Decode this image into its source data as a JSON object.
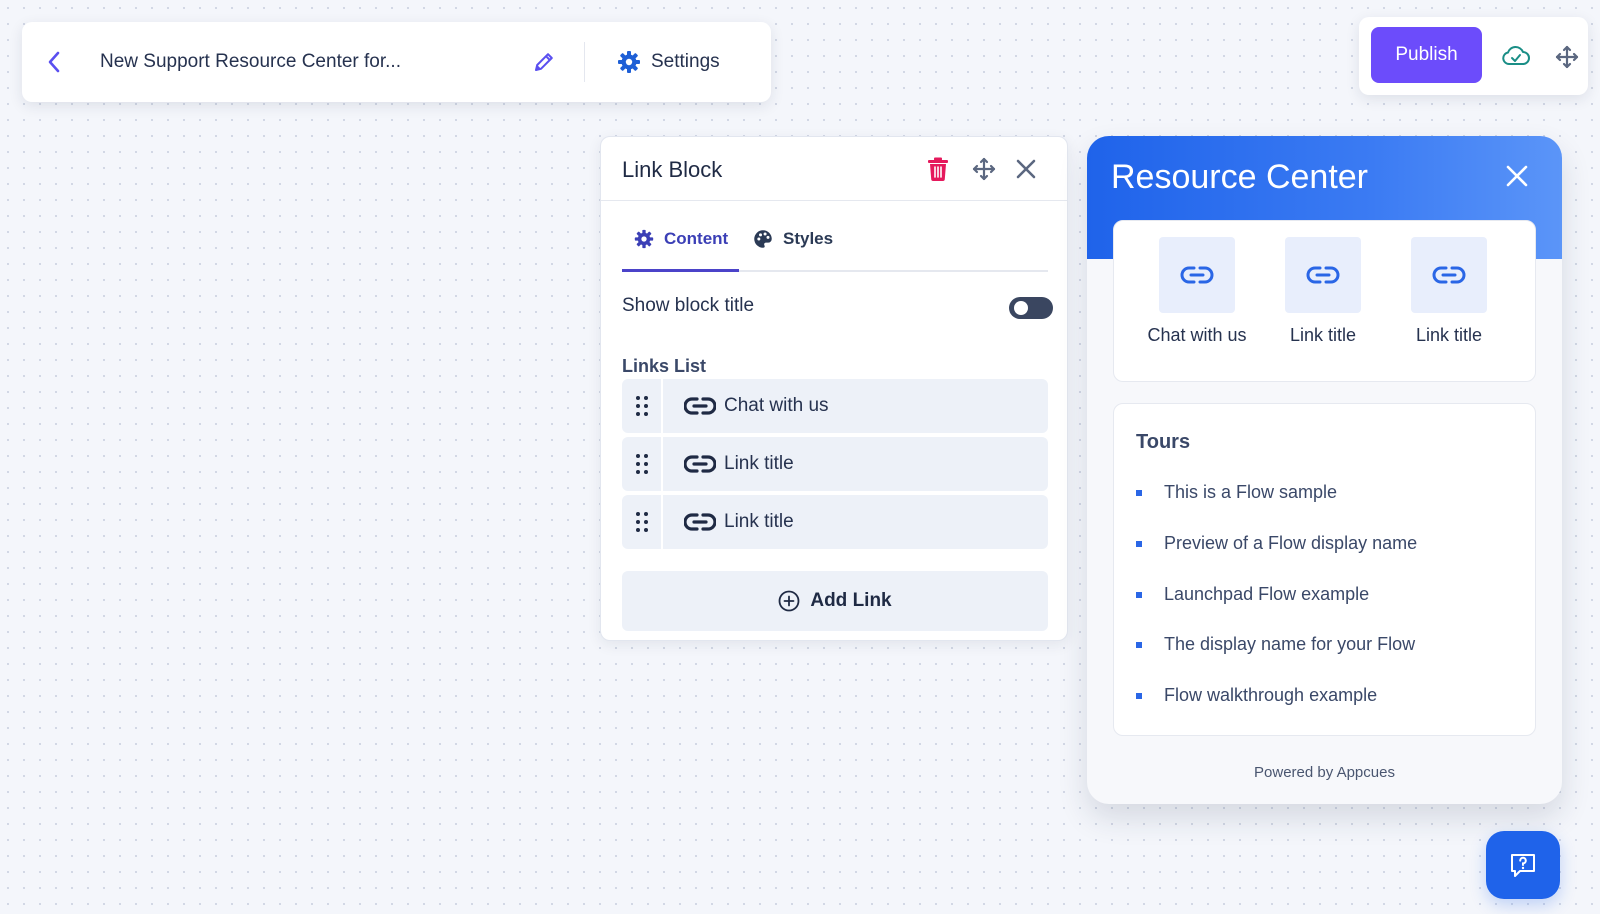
{
  "header": {
    "flow_name": "New Support Resource Center for...",
    "settings_label": "Settings"
  },
  "publish": {
    "publish_label": "Publish"
  },
  "link_block": {
    "title": "Link Block",
    "tabs": [
      {
        "label": "Content",
        "icon": "gear-icon",
        "active": true
      },
      {
        "label": "Styles",
        "icon": "palette-icon",
        "active": false
      }
    ],
    "show_block_title_label": "Show block title",
    "show_block_title_enabled": false,
    "links_heading": "Links List",
    "links": [
      {
        "label": "Chat with us"
      },
      {
        "label": "Link title"
      },
      {
        "label": "Link title"
      }
    ],
    "add_link_label": "Add Link"
  },
  "resource_center": {
    "title": "Resource Center",
    "links": [
      {
        "label": "Chat with us"
      },
      {
        "label": "Link title"
      },
      {
        "label": "Link title"
      }
    ],
    "tours_heading": "Tours",
    "tours": [
      "This is a Flow sample",
      "Preview of a Flow display name",
      "Launchpad Flow example",
      "The display name for your Flow",
      "Flow walkthrough example"
    ],
    "powered_by": "Powered by Appcues"
  },
  "colors": {
    "primary_purple": "#6c4cfb",
    "accent_blue": "#1f63ea",
    "danger_red": "#e5195c",
    "tab_active": "#3b3fb6"
  }
}
